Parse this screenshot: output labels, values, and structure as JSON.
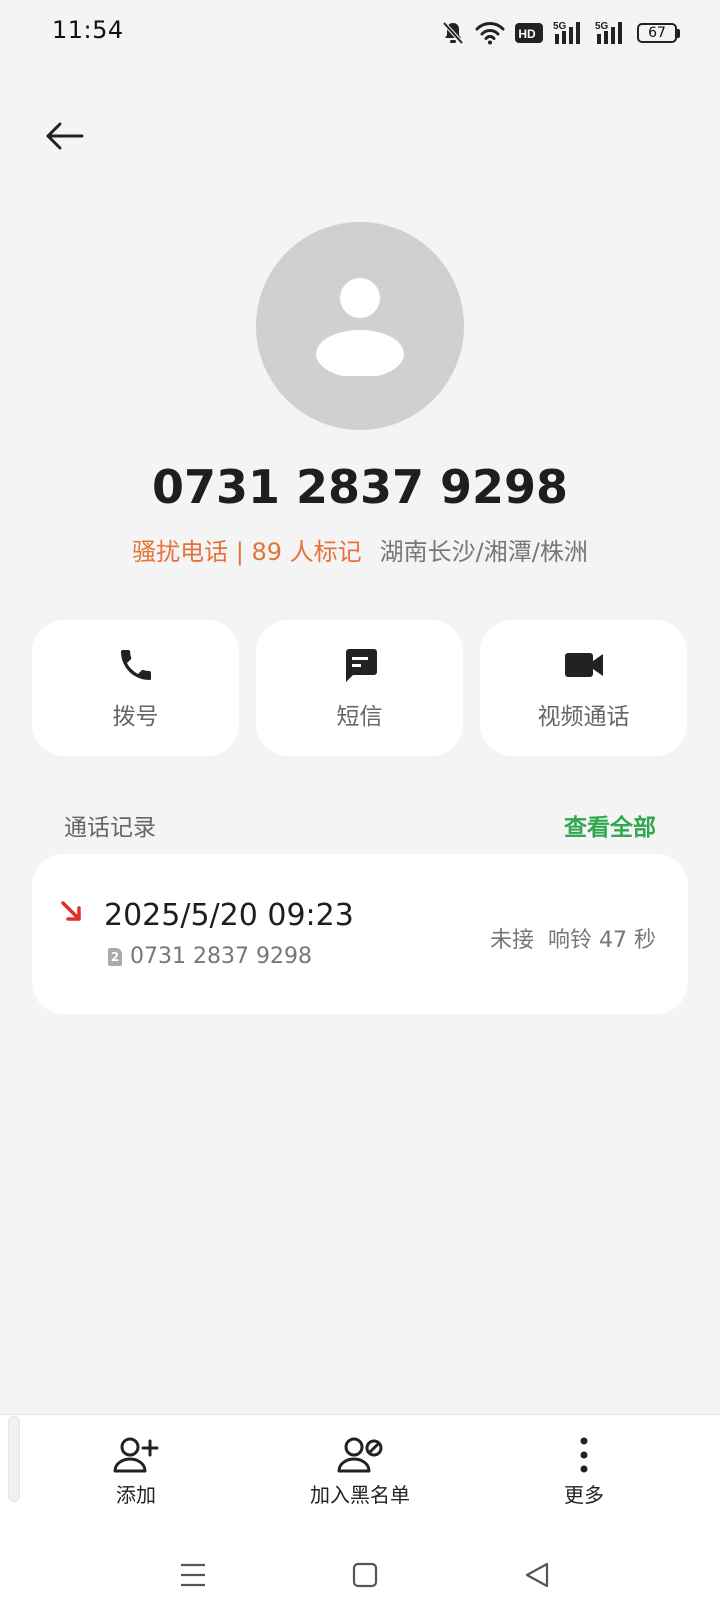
{
  "status_bar": {
    "time": "11:54",
    "icons": [
      "bell-off-icon",
      "wifi-icon",
      "hd-icon",
      "signal-5g-icon",
      "signal-5g-icon"
    ],
    "hd_label": "HD",
    "network_label": "5G",
    "battery": "67"
  },
  "contact": {
    "number": "0731 2837 9298",
    "spam_tag": "骚扰电话 | 89 人标记",
    "location": "湖南长沙/湘潭/株洲"
  },
  "actions": {
    "dial": "拨号",
    "sms": "短信",
    "video": "视频通话"
  },
  "call_log": {
    "title": "通话记录",
    "view_all": "查看全部",
    "entries": [
      {
        "datetime": "2025/5/20 09:23",
        "sim": "2",
        "number": "0731 2837 9298",
        "status": "未接",
        "duration": "响铃 47 秒"
      }
    ]
  },
  "bottom_actions": {
    "add": "添加",
    "block": "加入黑名单",
    "more": "更多"
  },
  "colors": {
    "spam": "#e5733a",
    "link": "#2fa84f",
    "missed": "#e0302a",
    "background": "#f4f4f4"
  }
}
